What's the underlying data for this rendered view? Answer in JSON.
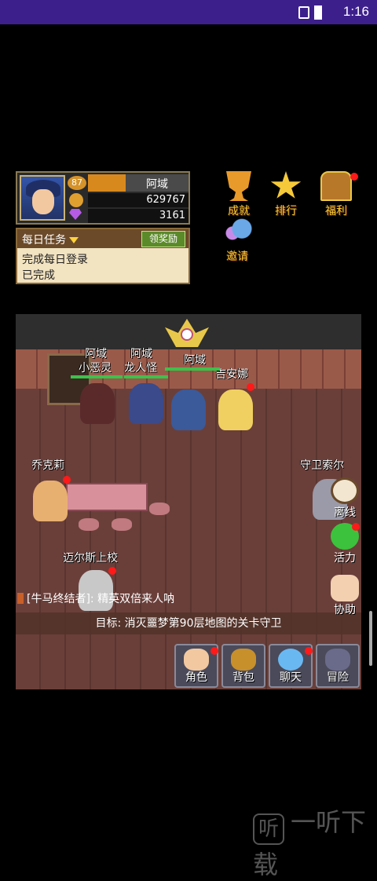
{
  "status_bar": {
    "time": "1:16",
    "icons": [
      "vibrate-icon",
      "battery-charging-icon"
    ]
  },
  "player": {
    "level": "87",
    "name": "阿域",
    "gold": "629767",
    "gems": "3161"
  },
  "daily_task": {
    "title": "每日任务",
    "claim_label": "领奖励",
    "task": "完成每日登录",
    "state": "已完成"
  },
  "top_menu": [
    {
      "label": "成就",
      "icon": "trophy-icon"
    },
    {
      "label": "排行",
      "icon": "rank-star-icon"
    },
    {
      "label": "福利",
      "icon": "treasure-chest-icon"
    },
    {
      "label": "邀请",
      "icon": "invite-icon"
    }
  ],
  "scene": {
    "names": {
      "imp_owner": "阿域",
      "imp": "小恶灵",
      "dragon_owner": "阿域",
      "dragon": "龙人怪",
      "player": "阿域",
      "gianna": "吉安娜",
      "joker": "乔克莉",
      "guard": "守卫索尔",
      "captain": "迈尔斯上校"
    }
  },
  "chat": {
    "text": "[牛马终结者]: 精英双倍来人呐"
  },
  "goal": {
    "text": "目标: 消灭噩梦第90层地图的关卡守卫"
  },
  "side_buttons": [
    {
      "label": "离线",
      "icon": "clock-icon"
    },
    {
      "label": "活力",
      "icon": "green-slime-icon"
    },
    {
      "label": "协助",
      "icon": "hand-icon"
    }
  ],
  "bottom_buttons": [
    {
      "label": "角色",
      "icon": "character-icon"
    },
    {
      "label": "背包",
      "icon": "backpack-icon"
    },
    {
      "label": "聊天",
      "icon": "chat-bubble-icon"
    },
    {
      "label": "冒险",
      "icon": "adventure-portal-icon"
    }
  ],
  "watermark": {
    "text": "一听下载",
    "logo": "听"
  },
  "colors": {
    "status_bar": "#3d1f8c",
    "accent_gold": "#f5c93a",
    "red_dot": "#ff1a1a"
  }
}
